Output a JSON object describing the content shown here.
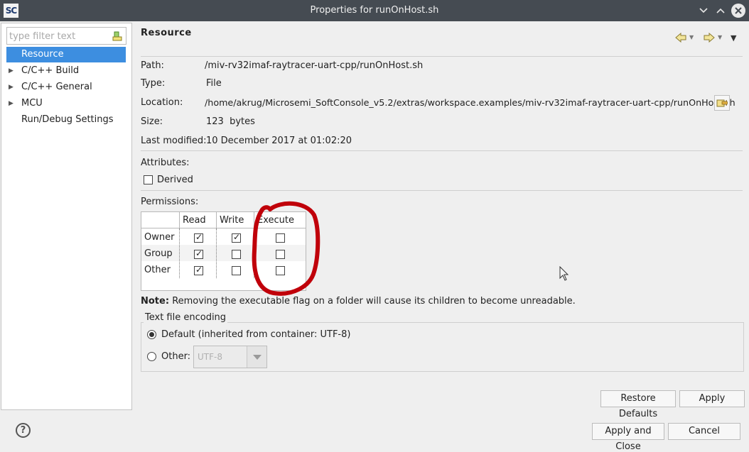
{
  "window": {
    "app_icon": "SC",
    "title": "Properties for runOnHost.sh",
    "icons": [
      "minimize-icon",
      "maximize-icon",
      "close-icon"
    ]
  },
  "sidebar": {
    "filter_placeholder": "type filter text",
    "items": [
      {
        "label": "Resource",
        "selected": true,
        "expandable": false
      },
      {
        "label": "C/C++ Build",
        "selected": false,
        "expandable": true
      },
      {
        "label": "C/C++ General",
        "selected": false,
        "expandable": true
      },
      {
        "label": "MCU",
        "selected": false,
        "expandable": true
      },
      {
        "label": "Run/Debug Settings",
        "selected": false,
        "expandable": false
      }
    ]
  },
  "page": {
    "title": "Resource",
    "fields": {
      "path_label": "Path:",
      "path_value": "/miv-rv32imaf-raytracer-uart-cpp/runOnHost.sh",
      "type_label": "Type:",
      "type_value": "File",
      "location_label": "Location:",
      "location_value": "/home/akrug/Microsemi_SoftConsole_v5.2/extras/workspace.examples/miv-rv32imaf-raytracer-uart-cpp/runOnHost.sh",
      "size_label": "Size:",
      "size_value": "123  bytes",
      "modified_label": "Last modified:",
      "modified_value": "10 December 2017 at 01:02:20"
    },
    "attributes_label": "Attributes:",
    "derived_label": "Derived",
    "derived_checked": false,
    "permissions_label": "Permissions:",
    "permissions": {
      "columns": [
        "Read",
        "Write",
        "Execute"
      ],
      "rows": [
        {
          "name": "Owner",
          "read": true,
          "write": true,
          "execute": false
        },
        {
          "name": "Group",
          "read": true,
          "write": false,
          "execute": false
        },
        {
          "name": "Other",
          "read": true,
          "write": false,
          "execute": false
        }
      ]
    },
    "note_bold": "Note:",
    "note_text": "Removing the executable flag on a folder will cause its children to become unreadable.",
    "encoding": {
      "group_label": "Text file encoding",
      "default_label": "Default (inherited from container: UTF-8)",
      "other_label": "Other:",
      "other_value": "UTF-8",
      "selected": "default"
    },
    "restore_defaults_label": "Restore Defaults",
    "apply_label": "Apply"
  },
  "footer": {
    "help_label": "?",
    "apply_close_label": "Apply and Close",
    "cancel_label": "Cancel"
  },
  "colors": {
    "selection": "#3d8ee0",
    "titlebar": "#454b52",
    "annotation": "#c0000a"
  }
}
